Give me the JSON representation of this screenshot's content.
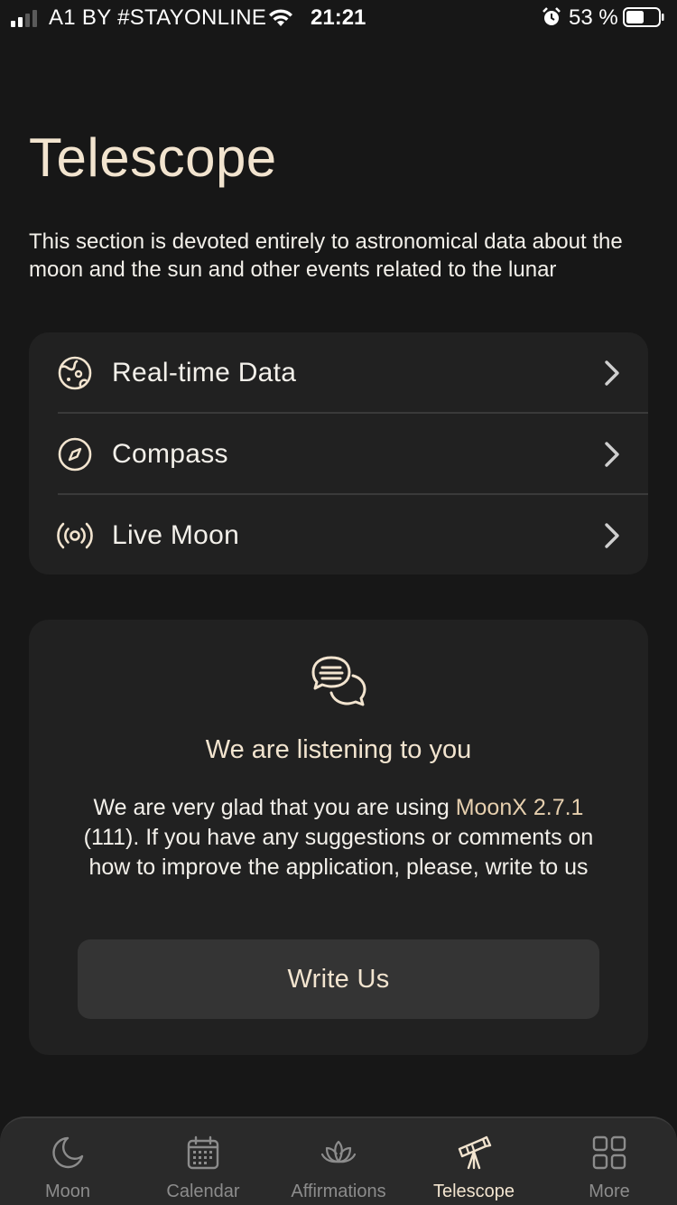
{
  "status_bar": {
    "carrier": "A1 BY #STAYONLINE",
    "time": "21:21",
    "battery": "53 %"
  },
  "page": {
    "title": "Telescope",
    "description": "This section is devoted entirely to astronomical data about the moon and the sun and other events related to the lunar"
  },
  "menu": {
    "items": [
      {
        "label": "Real-time Data",
        "icon": "globe-icon"
      },
      {
        "label": "Compass",
        "icon": "compass-icon"
      },
      {
        "label": "Live Moon",
        "icon": "broadcast-icon"
      }
    ]
  },
  "feedback": {
    "icon": "chat-bubbles-icon",
    "title": "We are listening to you",
    "text_before": "We are very glad that you are using ",
    "app_version": "MoonX 2.7.1",
    "text_after": "(111). If you have any suggestions or comments on how to improve the application, please, write to us",
    "button_label": "Write Us"
  },
  "tabs": [
    {
      "label": "Moon",
      "icon": "moon-icon",
      "active": false
    },
    {
      "label": "Calendar",
      "icon": "calendar-icon",
      "active": false
    },
    {
      "label": "Affirmations",
      "icon": "lotus-icon",
      "active": false
    },
    {
      "label": "Telescope",
      "icon": "telescope-icon",
      "active": true
    },
    {
      "label": "More",
      "icon": "grid-icon",
      "active": false
    }
  ],
  "colors": {
    "background": "#171717",
    "card": "#212121",
    "accent": "#f2e4cf",
    "inactive_tab": "#8c8c8c"
  }
}
